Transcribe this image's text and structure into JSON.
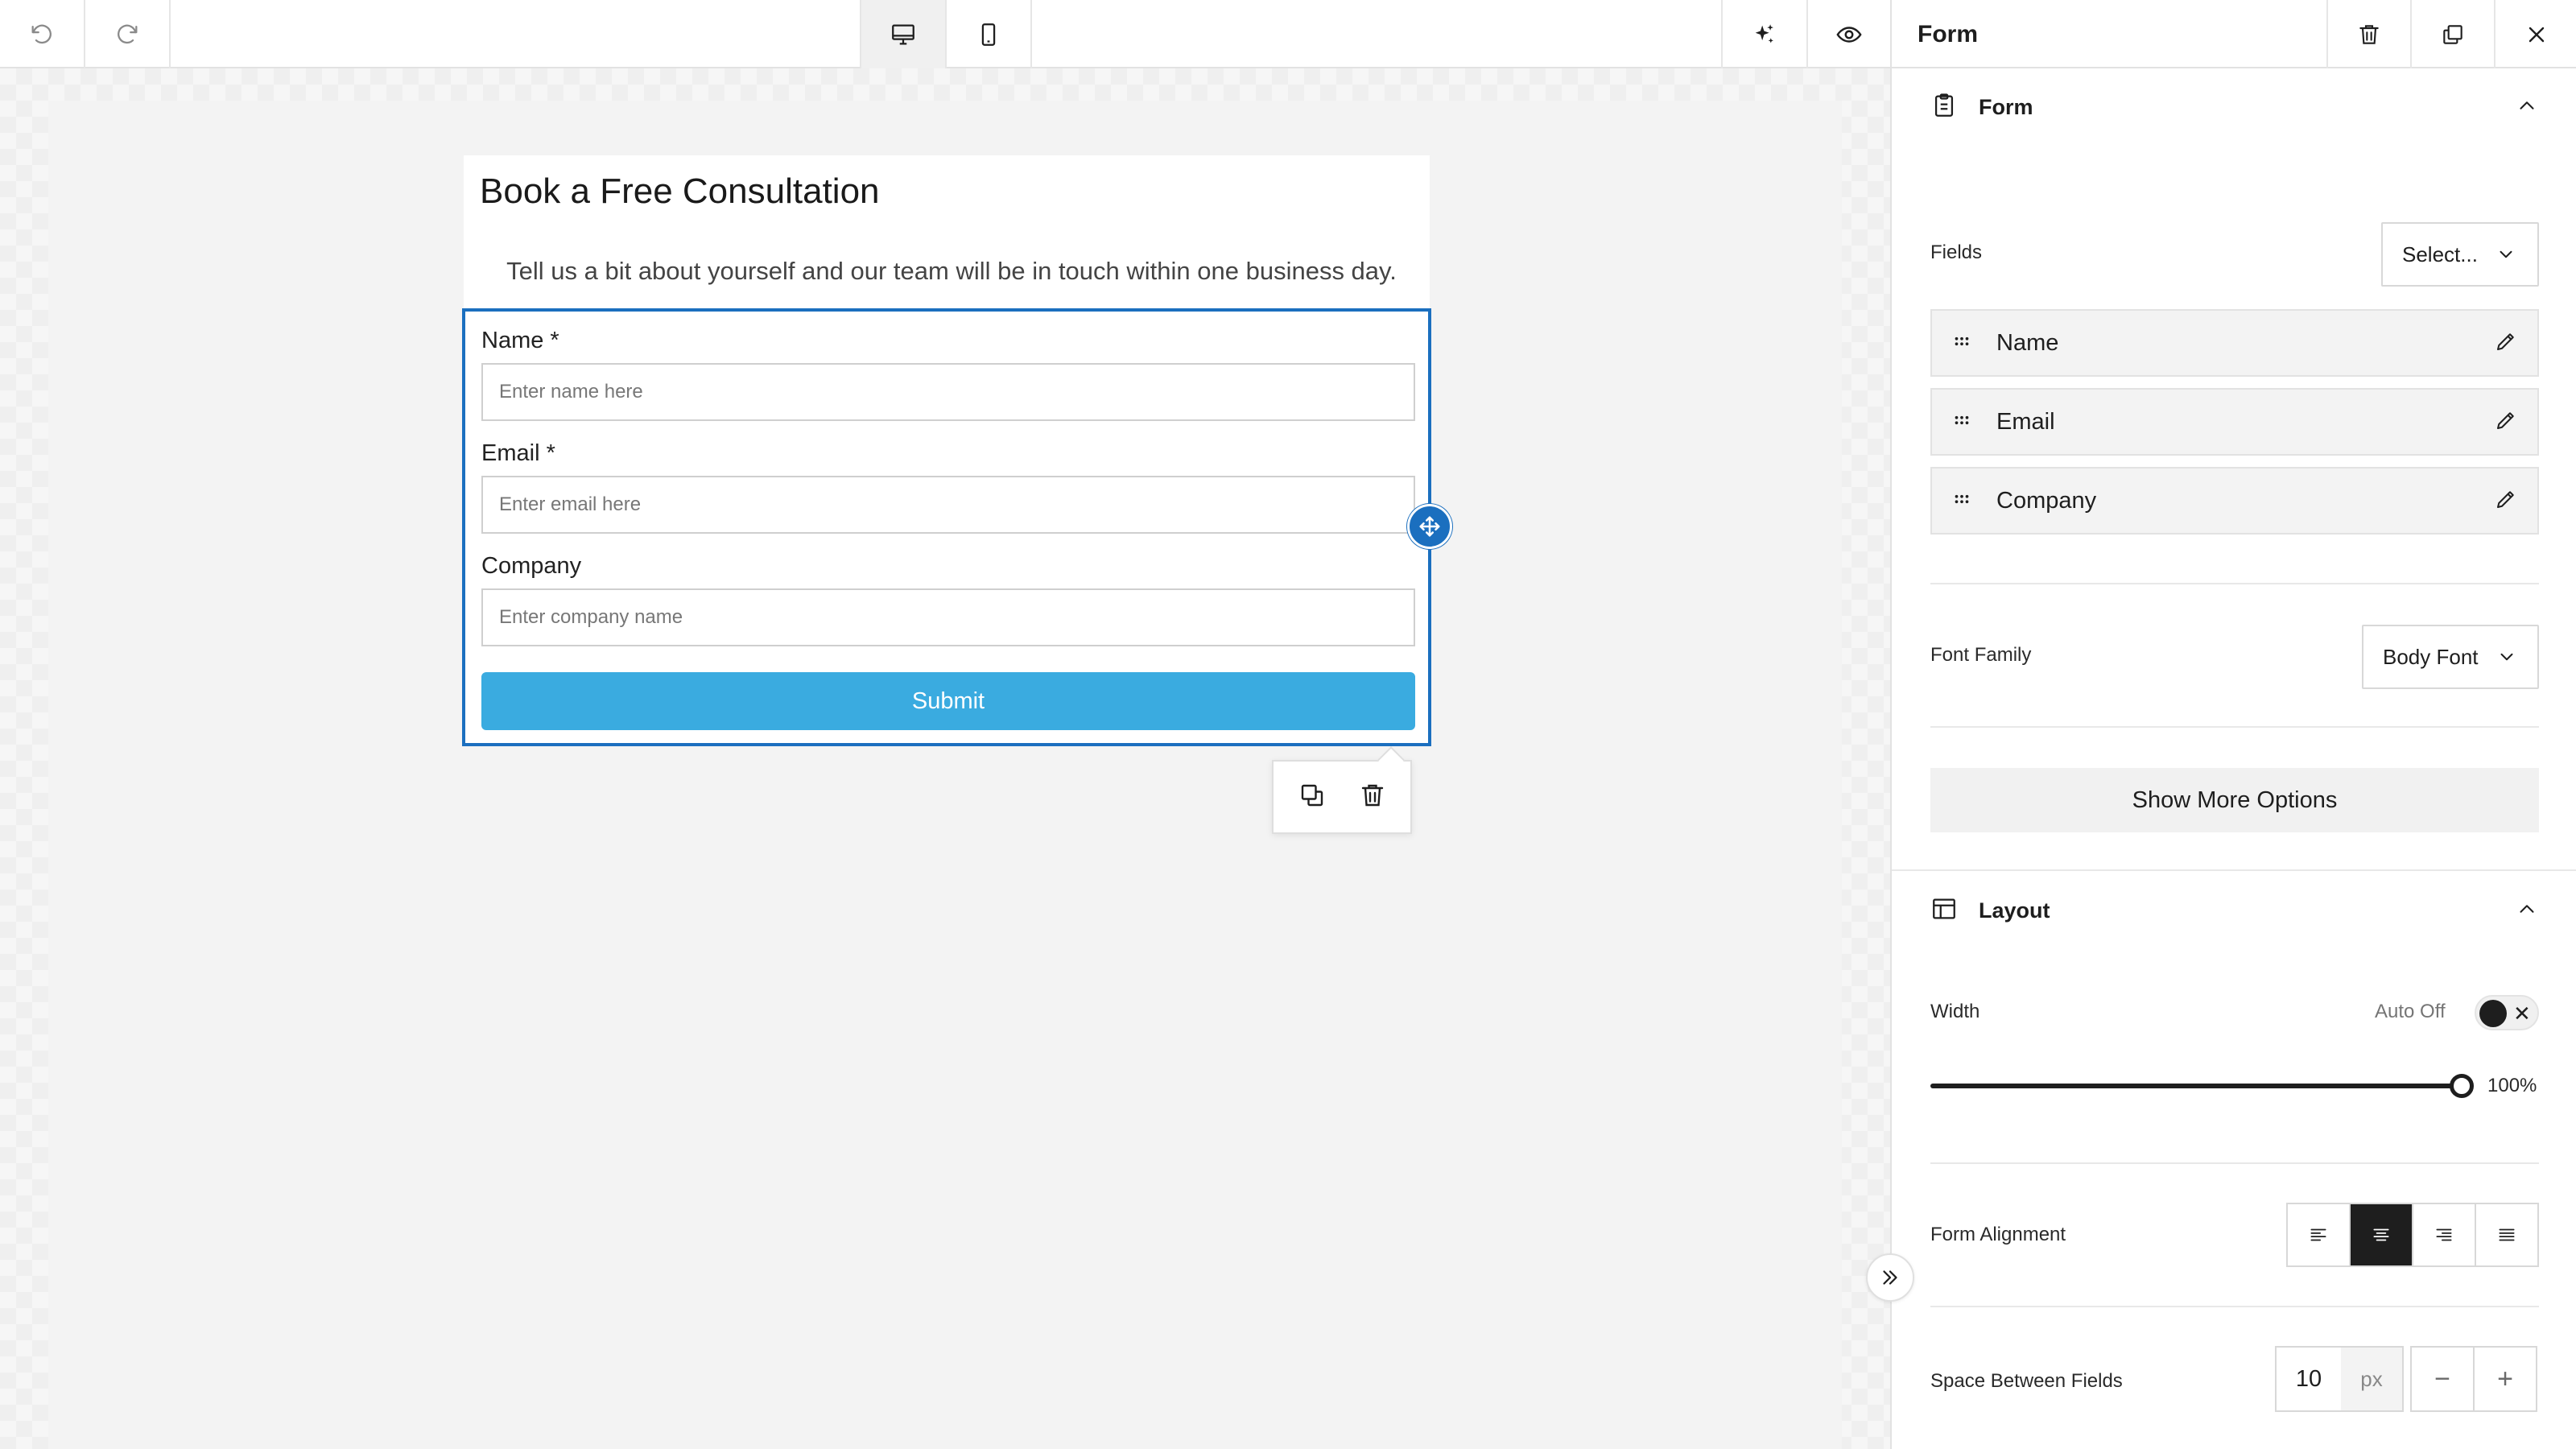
{
  "toolbar": {
    "undo_icon": "undo-icon",
    "redo_icon": "redo-icon",
    "desktop_icon": "desktop-icon",
    "mobile_icon": "mobile-icon",
    "ai_icon": "sparkle-icon",
    "preview_icon": "eye-icon"
  },
  "form_preview": {
    "title": "Book a Free Consultation",
    "subtitle": "Tell us a bit about yourself and our team will be in touch within one business day.",
    "fields": [
      {
        "label": "Name *",
        "placeholder": "Enter name here"
      },
      {
        "label": "Email *",
        "placeholder": "Enter email here"
      },
      {
        "label": "Company",
        "placeholder": "Enter company name"
      }
    ],
    "submit_label": "Submit"
  },
  "panel": {
    "title": "Form",
    "form_section": {
      "title": "Form",
      "fields_label": "Fields",
      "fields_select": "Select...",
      "items": [
        {
          "name": "Name"
        },
        {
          "name": "Email"
        },
        {
          "name": "Company"
        }
      ],
      "font_family_label": "Font Family",
      "font_family_value": "Body Font",
      "more_options_label": "Show More Options"
    },
    "layout_section": {
      "title": "Layout",
      "width_label": "Width",
      "auto_label": "Auto Off",
      "auto_enabled": false,
      "width_value": "100%",
      "width_fraction": 1.0,
      "alignment_label": "Form Alignment",
      "alignment_selected": "center",
      "space_label": "Space Between Fields",
      "space_value": "10",
      "space_unit": "px",
      "decrement": "−",
      "increment": "+"
    }
  },
  "colors": {
    "accent": "#1b6fbf",
    "submit": "#3aabe0"
  }
}
